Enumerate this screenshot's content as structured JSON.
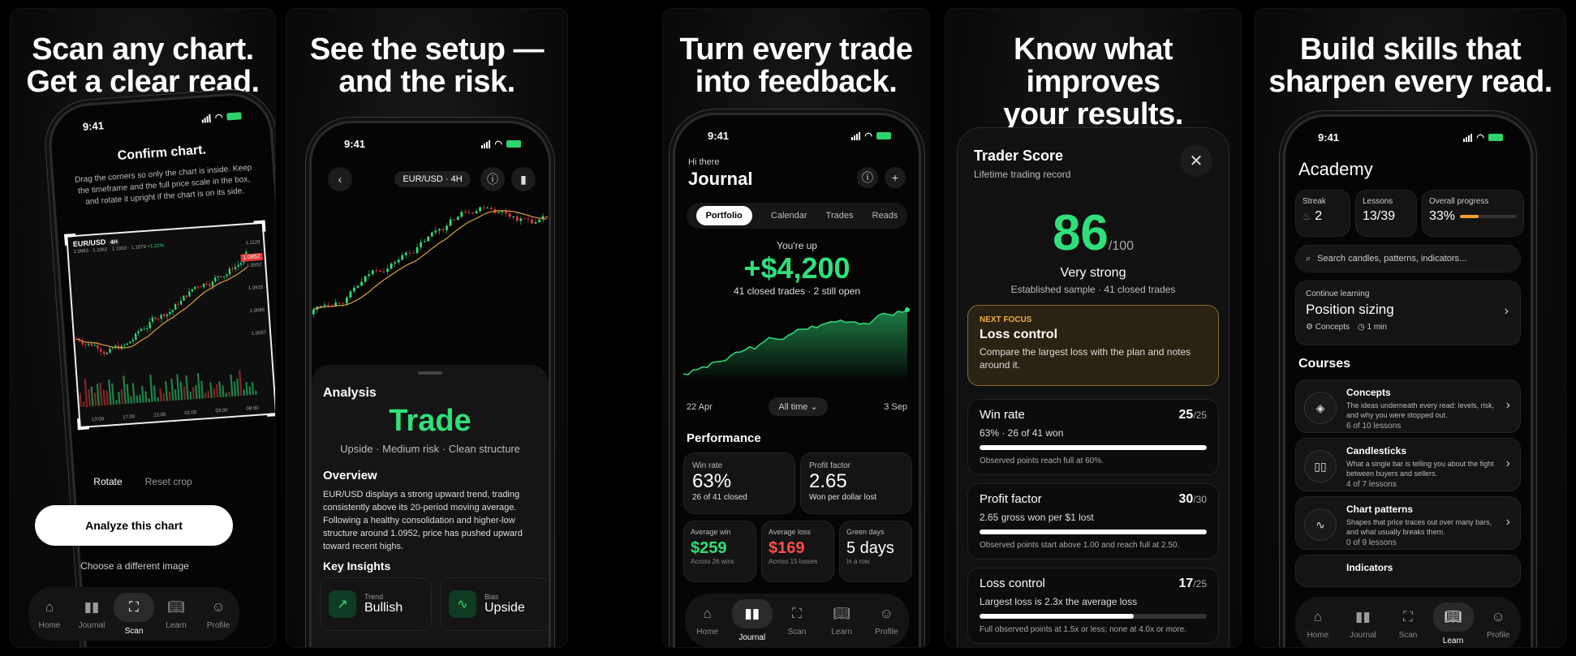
{
  "panels": [
    {
      "headline_line1": "Scan any chart.",
      "headline_line2": "Get a clear read."
    },
    {
      "headline_line1": "See the setup —",
      "headline_line2": "and the risk."
    },
    {
      "headline_line1": "Turn every trade",
      "headline_line2": "into feedback."
    },
    {
      "headline_line1": "Know what improves",
      "headline_line2": "your results."
    },
    {
      "headline_line1": "Build skills that",
      "headline_line2": "sharpen every read."
    }
  ],
  "status_time": "9:41",
  "scan": {
    "title": "Confirm chart.",
    "instructions": "Drag the corners so only the chart is inside. Keep the timeframe and the full price scale in the box, and rotate it upright if the chart is on its side.",
    "chart_symbol": "EUR/USD",
    "chart_tf": "4H",
    "ohlc": "1.0983 · 1.1062 · 1.1003 · 1.1079",
    "change": "+1.22%",
    "price_tag": "1.0952",
    "y_ticks": [
      "1.1120",
      "1.0952",
      "1.0915",
      "1.0085",
      "1.0057"
    ],
    "x_ticks": [
      "13:00",
      "17:00",
      "21:00",
      "01:00",
      "03:00",
      "08:00"
    ],
    "rotate_label": "Rotate",
    "reset_label": "Reset crop",
    "analyze_label": "Analyze this chart",
    "choose_label": "Choose a different image"
  },
  "tabs_nav": {
    "home": "Home",
    "journal": "Journal",
    "scan": "Scan",
    "learn": "Learn",
    "profile": "Profile"
  },
  "setup": {
    "pair_tf": "EUR/USD · 4H",
    "section": "Analysis",
    "verdict": "Trade",
    "summary": "Upside · Medium risk · Clean structure",
    "overview_title": "Overview",
    "overview_text": "EUR/USD displays a strong upward trend, trading consistently above its 20-period moving average. Following a healthy consolidation and higher-low structure around 1.0952, price has pushed upward toward recent highs.",
    "insights_title": "Key Insights",
    "insight1_label": "Trend",
    "insight1_value": "Bullish",
    "insight2_label": "Bias",
    "insight2_value": "Upside"
  },
  "journal": {
    "greeting": "Hi there",
    "title": "Journal",
    "tabs": [
      "Portfolio",
      "Calendar",
      "Trades",
      "Reads"
    ],
    "up_label": "You're up",
    "pnl": "+$4,200",
    "trades_note": "41 closed trades · 2 still open",
    "date_start": "22 Apr",
    "range": "All time",
    "date_end": "3 Sep",
    "performance_title": "Performance",
    "winrate_label": "Win rate",
    "winrate_value": "63%",
    "winrate_sub": "26 of 41 closed",
    "pf_label": "Profit factor",
    "pf_value": "2.65",
    "pf_sub": "Won per dollar lost",
    "avgwin_label": "Average win",
    "avgwin_value": "$259",
    "avgwin_sub": "Across 26 wins",
    "avgloss_label": "Average loss",
    "avgloss_value": "$169",
    "avgloss_sub": "Across 15 losses",
    "green_label": "Green days",
    "green_value": "5 days",
    "green_sub": "In a row"
  },
  "score": {
    "title": "Trader Score",
    "subtitle": "Lifetime trading record",
    "value": "86",
    "max": "/100",
    "grade": "Very strong",
    "sample": "Established sample · 41 closed trades",
    "focus_label": "NEXT FOCUS",
    "focus_title": "Loss control",
    "focus_text": "Compare the largest loss with the plan and notes around it.",
    "metrics": [
      {
        "name": "Win rate",
        "score": "25",
        "max": "/25",
        "detail": "63% · 26 of 41 won",
        "note": "Observed points reach full at 60%.",
        "fill": 1.0
      },
      {
        "name": "Profit factor",
        "score": "30",
        "max": "/30",
        "detail": "2.65 gross won per $1 lost",
        "note": "Observed points start above 1.00 and reach full at 2.50.",
        "fill": 1.0
      },
      {
        "name": "Loss control",
        "score": "17",
        "max": "/25",
        "detail": "Largest loss is 2.3x the average loss",
        "note": "Full observed points at 1.5x or less; none at 4.0x or more.",
        "fill": 0.68
      }
    ]
  },
  "academy": {
    "title": "Academy",
    "streak_label": "Streak",
    "streak_value": "2",
    "lessons_label": "Lessons",
    "lessons_value": "13/39",
    "progress_label": "Overall progress",
    "progress_value": "33%",
    "progress_fill": 0.33,
    "search_placeholder": "Search candles, patterns, indicators...",
    "continue_label": "Continue learning",
    "continue_title": "Position sizing",
    "continue_tag": "Concepts",
    "continue_time": "1 min",
    "courses_title": "Courses",
    "courses": [
      {
        "name": "Concepts",
        "desc": "The ideas underneath every read: levels, risk, and why you were stopped out.",
        "count": "6 of 10 lessons",
        "icon": "layers-icon"
      },
      {
        "name": "Candlesticks",
        "desc": "What a single bar is telling you about the fight between buyers and sellers.",
        "count": "4 of 7 lessons",
        "icon": "candles-icon"
      },
      {
        "name": "Chart patterns",
        "desc": "Shapes that price traces out over many bars, and what usually breaks them.",
        "count": "0 of 9 lessons",
        "icon": "pulse-icon"
      }
    ],
    "partial_course": "Indicators"
  }
}
